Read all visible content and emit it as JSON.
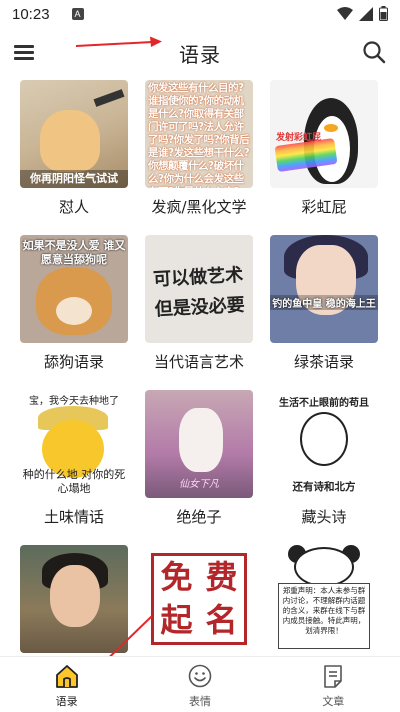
{
  "status_bar": {
    "time": "10:23",
    "notification_icon_text": "A",
    "icons": [
      "wifi-icon",
      "signal-icon",
      "battery-icon"
    ]
  },
  "header": {
    "title": "语录",
    "menu_icon": "hamburger-menu-icon",
    "search_icon": "search-icon"
  },
  "annotation_color": "#e3262a",
  "categories": [
    {
      "label": "怼人",
      "thumb_caption": "你再阴阳怪气试试"
    },
    {
      "label": "发疯/黑化文学",
      "thumb_caption": "你发这些有什么目的?谁指使你的?你的动机是什么?你取得有关部门许可了吗?法人允许了吗?你发了吗?你背后是谁?发这些想干什么?你想颠覆什么?破坏什么?你为什么会发这些东西?你是什么心态?"
    },
    {
      "label": "彩虹屁",
      "thumb_caption": "发射彩虹屁"
    },
    {
      "label": "舔狗语录",
      "thumb_caption": "如果不是没人爱 谁又愿意当舔狗呢"
    },
    {
      "label": "当代语言艺术",
      "thumb_caption": "可以做艺术 但是没必要"
    },
    {
      "label": "绿茶语录",
      "thumb_caption": "钓的鱼中皇 稳的海上王"
    },
    {
      "label": "土味情话",
      "thumb_caption_top": "宝，我今天去种地了",
      "thumb_caption_bottom": "种的什么地 对你的死心塌地"
    },
    {
      "label": "绝绝子",
      "thumb_caption": "仙女下凡"
    },
    {
      "label": "藏头诗",
      "thumb_caption_top": "生活不止眼前的苟且",
      "thumb_caption_bottom": "还有诗和北方"
    },
    {
      "label": "",
      "thumb_caption": ""
    },
    {
      "label": "",
      "seal_chars": [
        "免",
        "费",
        "起",
        "名"
      ]
    },
    {
      "label": "",
      "thumb_caption": "郑重声明：本人未参与群内讨论，不理解群内话题的含义，来群在线下与群内成员接触。特此声明，划清界限！"
    }
  ],
  "bottom_nav": [
    {
      "label": "语录",
      "icon": "home-icon",
      "active": true
    },
    {
      "label": "表情",
      "icon": "smiley-icon",
      "active": false
    },
    {
      "label": "文章",
      "icon": "document-icon",
      "active": false
    }
  ]
}
